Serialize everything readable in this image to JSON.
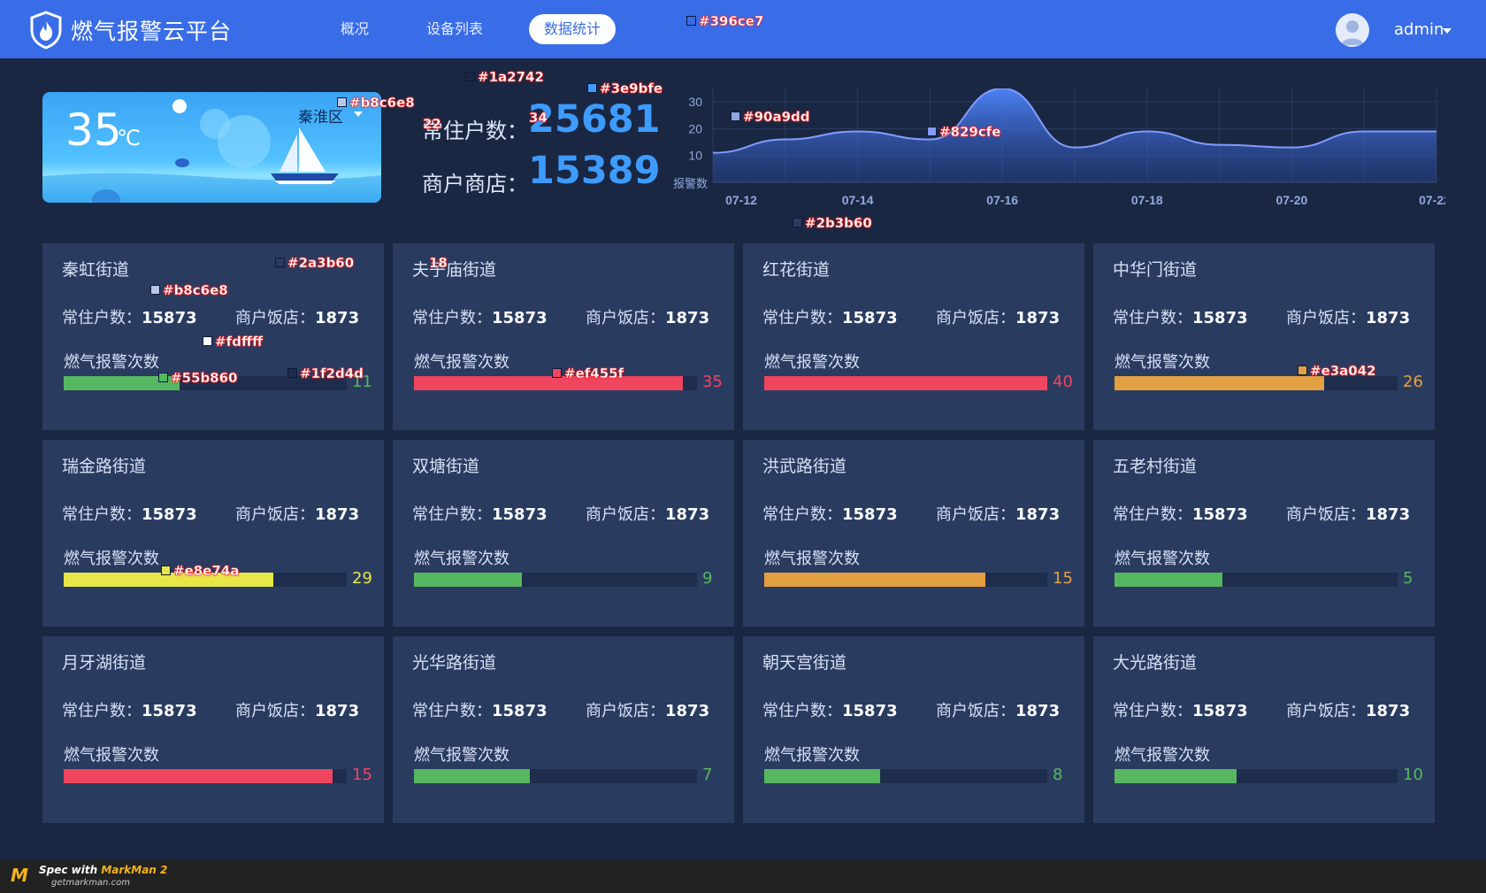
{
  "app": {
    "title": "燃气报警云平台"
  },
  "nav": {
    "items": [
      {
        "label": "概况",
        "active": false
      },
      {
        "label": "设备列表",
        "active": false
      },
      {
        "label": "数据统计",
        "active": true
      }
    ]
  },
  "user": {
    "name": "admin"
  },
  "weather": {
    "temperature": "35",
    "unit": "℃",
    "district": "秦淮区"
  },
  "stats": {
    "resident_label": "常住户数：",
    "resident_value": "25681",
    "shop_label": "商户商店：",
    "shop_value": "15389"
  },
  "chart_data": {
    "type": "area",
    "x": [
      "07-12",
      "07-13",
      "07-14",
      "07-15",
      "07-16",
      "07-17",
      "07-18",
      "07-19",
      "07-20",
      "07-21",
      "07-22"
    ],
    "x_tick_labels": [
      "07-12",
      "07-14",
      "07-16",
      "07-18",
      "07-20",
      "07-22"
    ],
    "y_tick_labels": [
      "10",
      "20",
      "30"
    ],
    "ylim": [
      0,
      35
    ],
    "ylabel": "报警数",
    "series": [
      {
        "values": [
          11,
          16,
          19,
          16,
          35,
          13,
          19,
          14,
          13,
          19,
          19
        ]
      }
    ],
    "grid": true
  },
  "card_labels": {
    "resident": "常住户数：",
    "shop": "商户饭店：",
    "alarm": "燃气报警次数"
  },
  "streets": [
    {
      "name": "秦虹街道",
      "resident": "15873",
      "shop": "1873",
      "alarms": "11",
      "fill": 0.41,
      "color": "#55b860"
    },
    {
      "name": "夫子庙街道",
      "resident": "15873",
      "shop": "1873",
      "alarms": "35",
      "fill": 0.95,
      "color": "#ef455f"
    },
    {
      "name": "红花街道",
      "resident": "15873",
      "shop": "1873",
      "alarms": "40",
      "fill": 1.0,
      "color": "#ef455f"
    },
    {
      "name": "中华门街道",
      "resident": "15873",
      "shop": "1873",
      "alarms": "26",
      "fill": 0.74,
      "color": "#e3a042"
    },
    {
      "name": "瑞金路街道",
      "resident": "15873",
      "shop": "1873",
      "alarms": "29",
      "fill": 0.74,
      "color": "#e8e74a"
    },
    {
      "name": "双塘街道",
      "resident": "15873",
      "shop": "1873",
      "alarms": "9",
      "fill": 0.38,
      "color": "#55b860"
    },
    {
      "name": "洪武路街道",
      "resident": "15873",
      "shop": "1873",
      "alarms": "15",
      "fill": 0.78,
      "color": "#e3a042"
    },
    {
      "name": "五老村街道",
      "resident": "15873",
      "shop": "1873",
      "alarms": "5",
      "fill": 0.38,
      "color": "#55b860"
    },
    {
      "name": "月牙湖街道",
      "resident": "15873",
      "shop": "1873",
      "alarms": "15",
      "fill": 0.95,
      "color": "#ef455f"
    },
    {
      "name": "光华路街道",
      "resident": "15873",
      "shop": "1873",
      "alarms": "7",
      "fill": 0.41,
      "color": "#55b860"
    },
    {
      "name": "朝天宫街道",
      "resident": "15873",
      "shop": "1873",
      "alarms": "8",
      "fill": 0.41,
      "color": "#55b860"
    },
    {
      "name": "大光路街道",
      "resident": "15873",
      "shop": "1873",
      "alarms": "10",
      "fill": 0.43,
      "color": "#55b860"
    }
  ],
  "markers": [
    {
      "text": "#396ce7",
      "color": "#396ce7"
    },
    {
      "text": "#1a2742",
      "color": "#1a2742"
    },
    {
      "text": "#b8c6e8",
      "color": "#b8c6e8"
    },
    {
      "text": "#3e9bfe",
      "color": "#3e9bfe"
    },
    {
      "text": "22"
    },
    {
      "text": "34"
    },
    {
      "text": "#90a9dd",
      "color": "#90a9dd"
    },
    {
      "text": "#829cfe",
      "color": "#829cfe"
    },
    {
      "text": "#2b3b60",
      "color": "#2b3b60"
    },
    {
      "text": "#2a3b60",
      "color": "#2a3b60"
    },
    {
      "text": "#b8c6e8",
      "color": "#b8c6e8"
    },
    {
      "text": "#fdffff",
      "color": "#fdffff"
    },
    {
      "text": "#55b860",
      "color": "#55b860"
    },
    {
      "text": "#1f2d4d",
      "color": "#1f2d4d"
    },
    {
      "text": "18"
    },
    {
      "text": "#ef455f",
      "color": "#ef455f"
    },
    {
      "text": "#e3a042",
      "color": "#e3a042"
    },
    {
      "text": "#e8e74a",
      "color": "#e8e74a"
    }
  ],
  "footer": {
    "prefix": "Spec with ",
    "brand": "MarkMan 2",
    "site": "getmarkman.com"
  }
}
